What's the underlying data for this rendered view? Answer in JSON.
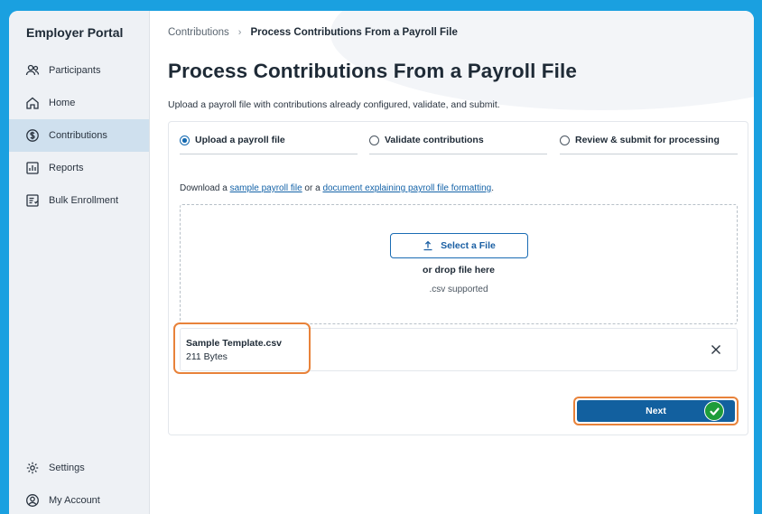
{
  "sidebar": {
    "brand": "Employer Portal",
    "items": [
      {
        "label": "Participants",
        "icon": "participants-icon"
      },
      {
        "label": "Home",
        "icon": "home-icon"
      },
      {
        "label": "Contributions",
        "icon": "contributions-icon",
        "active": true
      },
      {
        "label": "Reports",
        "icon": "reports-icon"
      },
      {
        "label": "Bulk Enrollment",
        "icon": "bulk-enrollment-icon"
      }
    ],
    "bottom_items": [
      {
        "label": "Settings",
        "icon": "gear-icon"
      },
      {
        "label": "My Account",
        "icon": "account-icon"
      }
    ]
  },
  "breadcrumb": {
    "parent": "Contributions",
    "separator": "›",
    "current": "Process Contributions From a Payroll File"
  },
  "page": {
    "title": "Process Contributions From a Payroll File",
    "subtitle": "Upload a payroll file with contributions already configured, validate, and submit."
  },
  "steps": [
    {
      "label": "Upload a payroll file",
      "active": true
    },
    {
      "label": "Validate contributions",
      "active": false
    },
    {
      "label": "Review & submit for processing",
      "active": false
    }
  ],
  "download": {
    "prefix": "Download a ",
    "link1": "sample payroll file",
    "middle": " or a ",
    "link2": "document explaining payroll file formatting",
    "suffix": "."
  },
  "dropzone": {
    "button_label": "Select a File",
    "drop_text": "or drop file here",
    "supported": ".csv supported"
  },
  "file": {
    "name": "Sample Template.csv",
    "size": "211 Bytes"
  },
  "actions": {
    "next_label": "Next"
  },
  "colors": {
    "accent": "#12609f",
    "highlight": "#e8823a",
    "success": "#1e9c3a",
    "frame": "#1aa0e0"
  }
}
